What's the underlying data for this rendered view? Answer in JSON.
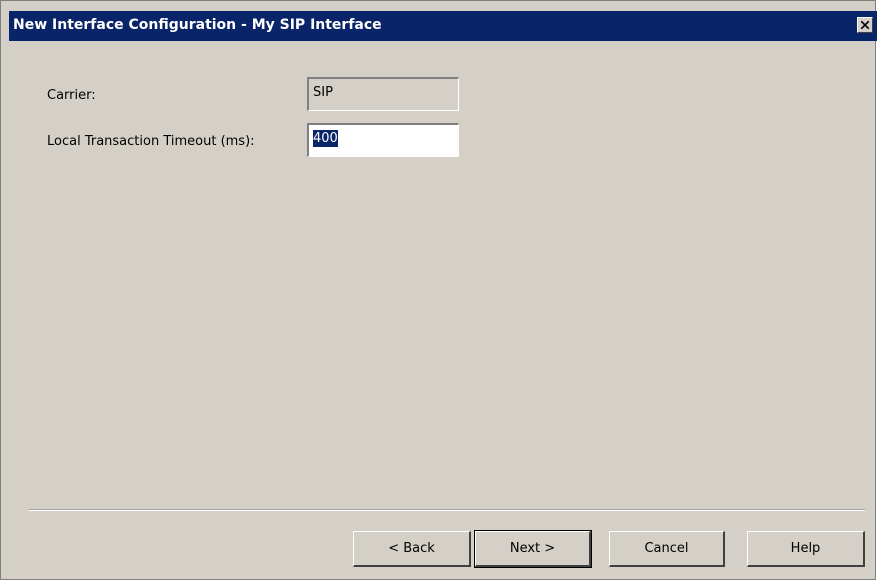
{
  "window": {
    "title": "New Interface Configuration - My SIP Interface"
  },
  "form": {
    "carrier_label": "Carrier:",
    "carrier_value": "SIP",
    "timeout_label": "Local Transaction Timeout (ms):",
    "timeout_value": "400"
  },
  "buttons": {
    "back": "< Back",
    "next": "Next >",
    "cancel": "Cancel",
    "help": "Help"
  },
  "icons": {
    "close": "close-icon"
  },
  "colors": {
    "titlebar": "#0a246a",
    "dialog_face": "#d4d0c8",
    "selection": "#0a246a"
  }
}
